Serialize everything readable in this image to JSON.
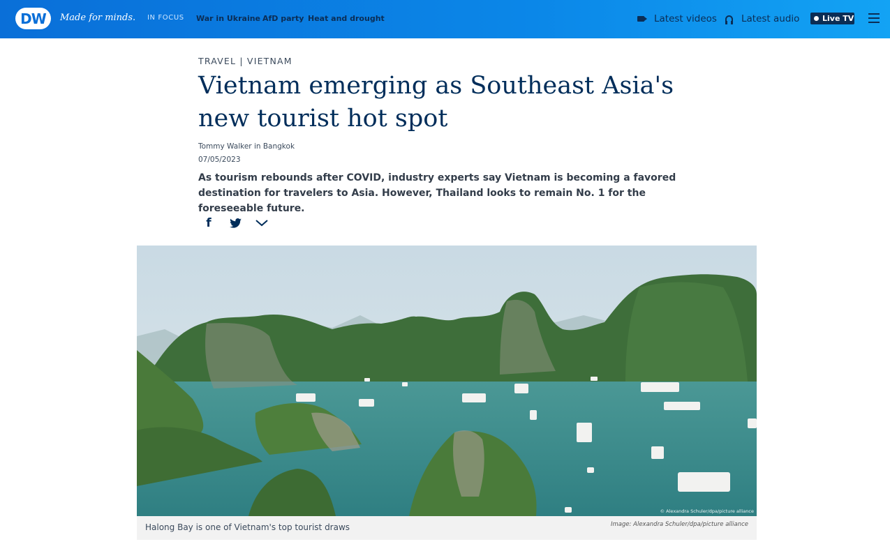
{
  "header": {
    "logo": "DW",
    "tagline": "Made for minds.",
    "in_focus_label": "IN FOCUS",
    "focus_links": [
      "War in Ukraine",
      "AfD party",
      "Heat and drought"
    ],
    "latest_videos": "Latest videos",
    "latest_audio": "Latest audio",
    "live_tv": "Live TV",
    "icons": [
      "video-camera-icon",
      "headphones-icon",
      "live-dot-icon",
      "hamburger-menu-icon"
    ]
  },
  "article": {
    "kicker": "TRAVEL | VIETNAM",
    "title": "Vietnam emerging as Southeast Asia's new tourist hot spot",
    "author": "Tommy Walker in Bangkok",
    "date": "07/05/2023",
    "teaser": "As tourism rebounds after COVID, industry experts say Vietnam is becoming a favored destination for travelers to Asia. However, Thailand looks to remain No. 1 for the foreseeable future.",
    "share_icons": [
      "facebook-icon",
      "twitter-icon",
      "chevron-down-icon"
    ]
  },
  "figure": {
    "photo_overlay_credit": "© Alexandra Schuler/dpa/picture alliance",
    "caption": "Halong Bay is one of Vietnam's top tourist draws",
    "credit": "Image: Alexandra Schuler/dpa/picture alliance"
  },
  "colors": {
    "header_gradient_start": "#0a6fd8",
    "header_gradient_end": "#13a3f4",
    "headline": "#002d5a",
    "water": "#3f8f8c",
    "sky": "#cfdde6"
  }
}
